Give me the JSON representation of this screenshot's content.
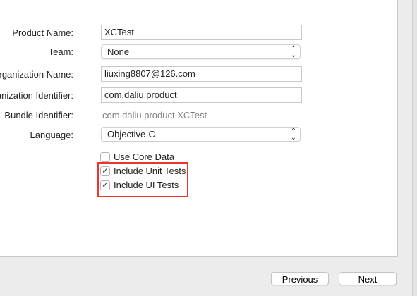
{
  "form": {
    "product_name": {
      "label": "Product Name:",
      "value": "XCTest"
    },
    "team": {
      "label": "Team:",
      "value": "None"
    },
    "organization_name": {
      "label": "Organization Name:",
      "value": "liuxing8807@126.com"
    },
    "organization_identifier": {
      "label": "Organization Identifier:",
      "value": "com.daliu.product"
    },
    "bundle_identifier": {
      "label": "Bundle Identifier:",
      "value": "com.daliu.product.XCTest"
    },
    "language": {
      "label": "Language:",
      "value": "Objective-C"
    },
    "checkboxes": [
      {
        "label": "Use Core Data",
        "checked": false
      },
      {
        "label": "Include Unit Tests",
        "checked": true
      },
      {
        "label": "Include UI Tests",
        "checked": true
      }
    ]
  },
  "footer": {
    "previous": "Previous",
    "next": "Next"
  },
  "highlight_color": "#f0332b"
}
